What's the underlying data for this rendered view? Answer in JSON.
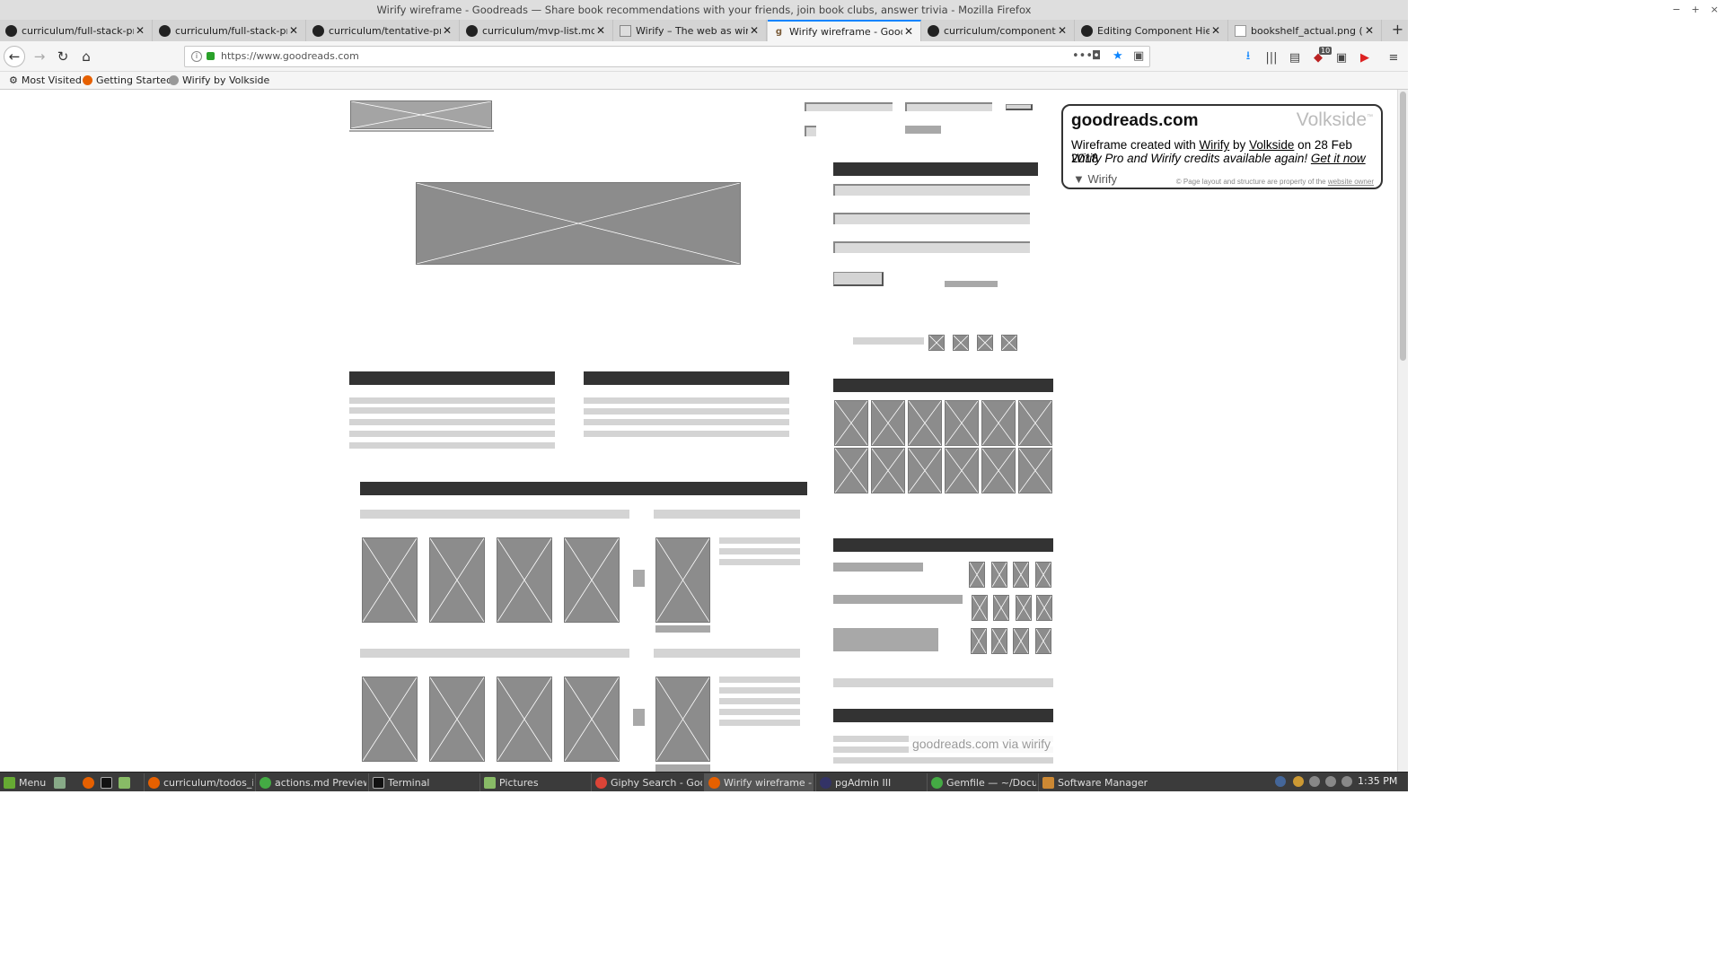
{
  "window": {
    "title": "Wirify wireframe - Goodreads — Share book recommendations with your friends, join book clubs, answer trivia - Mozilla Firefox",
    "controls": [
      "−",
      "+",
      "×"
    ]
  },
  "tabs": [
    {
      "label": "curriculum/full-stack-projec",
      "icon": "github-icon"
    },
    {
      "label": "curriculum/full-stack-projec",
      "icon": "github-icon"
    },
    {
      "label": "curriculum/tentative-proje",
      "icon": "github-icon"
    },
    {
      "label": "curriculum/mvp-list.md at r",
      "icon": "github-icon"
    },
    {
      "label": "Wirify – The web as wirefra",
      "icon": "wirify-icon"
    },
    {
      "label": "Wirify wireframe - Goodrea",
      "icon": "goodreads-icon"
    },
    {
      "label": "curriculum/component-hie",
      "icon": "github-icon"
    },
    {
      "label": "Editing Component Hierarc",
      "icon": "github-icon"
    },
    {
      "label": "bookshelf_actual.png (PNG",
      "icon": "image-icon"
    }
  ],
  "active_tab": 5,
  "new_tab": "+",
  "url": "https://www.goodreads.com",
  "toolbar": {
    "badge": "10"
  },
  "bookmarks": [
    "Most Visited",
    "Getting Started",
    "Wirify by Volkside"
  ],
  "wirify": {
    "site": "goodreads.com",
    "brand": "Volkside",
    "tm": "™",
    "line1_a": "Wireframe created with ",
    "line1_b": "Wirify",
    "line1_c": " by ",
    "line1_d": "Volkside",
    "line1_e": " on 28 Feb 2018",
    "line2_a": "Wirify Pro and Wirify credits available again! ",
    "line2_b": "Get it now",
    "toggle": "▼ Wirify",
    "copy_a": "© Page layout and structure are property of the ",
    "copy_b": "website owner"
  },
  "via": "goodreads.com via wirify",
  "taskbar": {
    "menu": "Menu",
    "apps": [
      "curriculum/todos_i....",
      "actions.md Preview...",
      "Terminal",
      "Pictures",
      "Giphy Search - Goo...",
      "Wirify wireframe - ...",
      "pgAdmin III",
      "Gemfile — ~/Docu...",
      "Software Manager"
    ],
    "clock": "1:35 PM"
  }
}
